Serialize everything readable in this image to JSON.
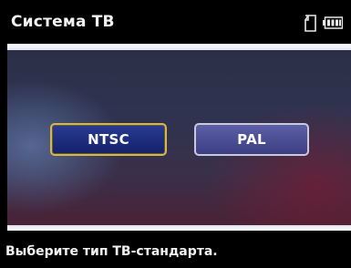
{
  "header": {
    "title": "Система ТВ",
    "icons": [
      "sd-card-icon",
      "battery-icon"
    ]
  },
  "options": [
    {
      "label": "NTSC",
      "selected": true
    },
    {
      "label": "PAL",
      "selected": false
    }
  ],
  "footer": {
    "hint": "Выберите тип ТВ-стандарта."
  },
  "colors": {
    "selected_border": "#d2b84e",
    "selected_fill": "#1d2c7c",
    "unselected_fill": "#4b4d93",
    "text": "#f2f2f2"
  }
}
